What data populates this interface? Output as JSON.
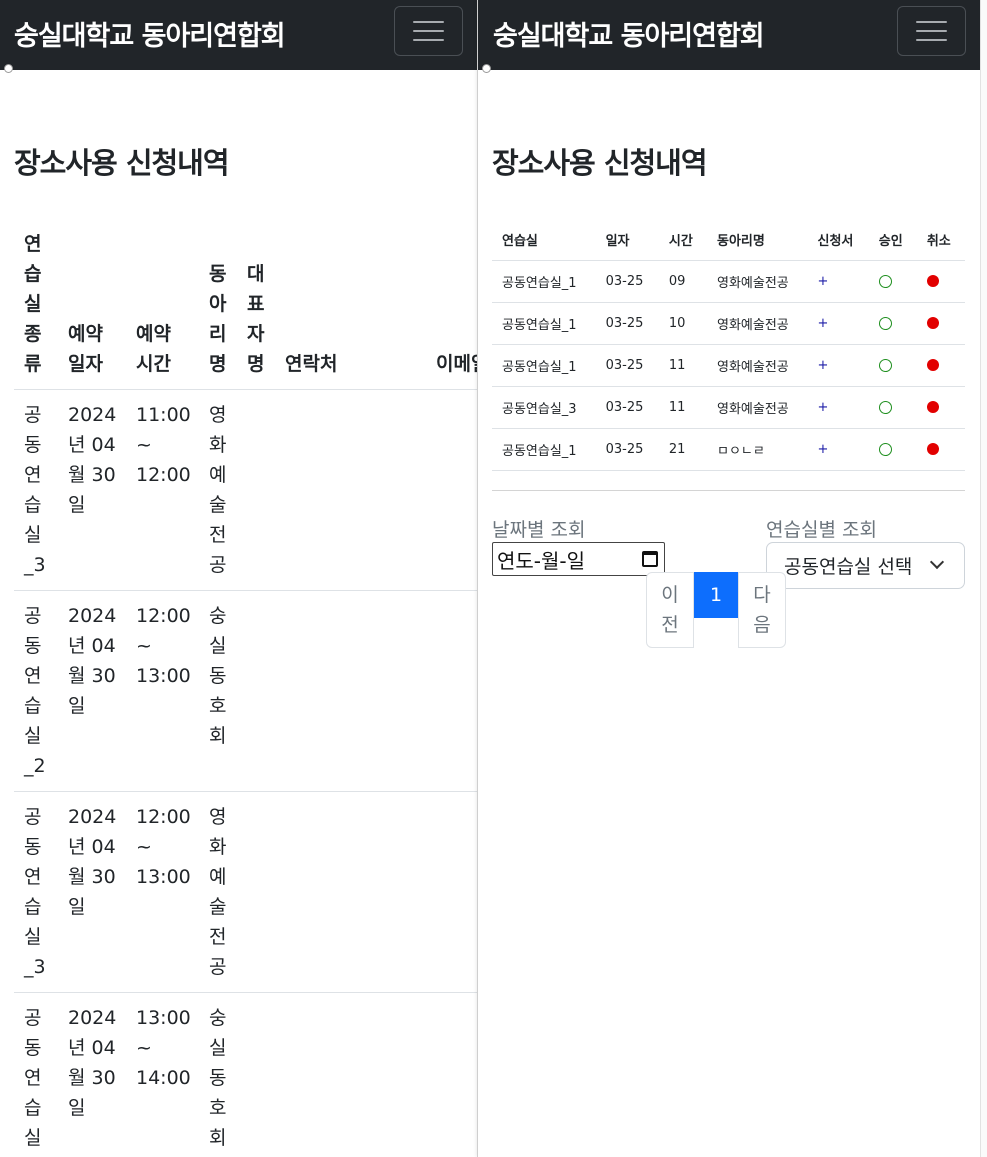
{
  "brand": "숭실대학교 동아리연합회",
  "page_title": "장소사용 신청내역",
  "left_table": {
    "headers": {
      "room_type": "연\n습\n실\n종\n류",
      "date": "예약\n일자",
      "time": "예약\n시간",
      "club": "동\n아\n리\n명",
      "rep": "대\n표\n자\n명",
      "contact": "연락처",
      "email": "이메일"
    },
    "rows": [
      {
        "room": "공\n동\n연\n습\n실\n_3",
        "date": "2024\n년 04\n월 30\n일",
        "time": "11:00\n~\n12:00",
        "club": "영\n화\n예\n술\n전\n공"
      },
      {
        "room": "공\n동\n연\n습\n실\n_2",
        "date": "2024\n년 04\n월 30\n일",
        "time": "12:00\n~\n13:00",
        "club": "숭\n실\n동\n호\n회"
      },
      {
        "room": "공\n동\n연\n습\n실\n_3",
        "date": "2024\n년 04\n월 30\n일",
        "time": "12:00\n~\n13:00",
        "club": "영\n화\n예\n술\n전\n공"
      },
      {
        "room": "공\n동\n연\n습\n실",
        "date": "2024\n년 04\n월 30\n일",
        "time": "13:00\n~\n14:00",
        "club": "숭\n실\n동\n호\n회"
      }
    ]
  },
  "right_table": {
    "headers": {
      "room": "연습실",
      "date": "일자",
      "time": "시간",
      "club": "동아리명",
      "form": "신청서",
      "approve": "승인",
      "cancel": "취소"
    },
    "rows": [
      {
        "room": "공동연습실_1",
        "date": "03-25",
        "time": "09",
        "club": "영화예술전공",
        "form": "+"
      },
      {
        "room": "공동연습실_1",
        "date": "03-25",
        "time": "10",
        "club": "영화예술전공",
        "form": "+"
      },
      {
        "room": "공동연습실_1",
        "date": "03-25",
        "time": "11",
        "club": "영화예술전공",
        "form": "+"
      },
      {
        "room": "공동연습실_3",
        "date": "03-25",
        "time": "11",
        "club": "영화예술전공",
        "form": "+"
      },
      {
        "room": "공동연습실_1",
        "date": "03-25",
        "time": "21",
        "club": "ㅁㅇㄴㄹ",
        "form": "+"
      }
    ]
  },
  "filters": {
    "date_label": "날짜별 조회",
    "date_placeholder": "연도-월-일",
    "room_label": "연습실별 조회",
    "room_select": "공동연습실 선택"
  },
  "pagination": {
    "prev": "이\n전",
    "current": "1",
    "next": "다\n음"
  },
  "colors": {
    "navbar": "#212529",
    "active_page": "#0d6efd",
    "cancel_dot": "#e20000",
    "approve_circle": "#1f8f1f"
  }
}
